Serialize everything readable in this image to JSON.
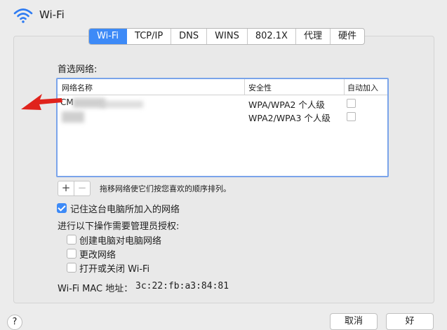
{
  "window": {
    "title": "Wi-Fi"
  },
  "tabs": [
    {
      "label": "Wi-Fi",
      "active": true
    },
    {
      "label": "TCP/IP"
    },
    {
      "label": "DNS"
    },
    {
      "label": "WINS"
    },
    {
      "label": "802.1X"
    },
    {
      "label": "代理"
    },
    {
      "label": "硬件"
    }
  ],
  "preferred": {
    "label": "首选网络:",
    "columns": [
      "网络名称",
      "安全性",
      "自动加入"
    ],
    "rows": [
      {
        "name": "CM",
        "security": "WPA/WPA2 个人级",
        "auto_join": false
      },
      {
        "name": "",
        "security": "WPA2/WPA3 个人级",
        "auto_join": false
      }
    ]
  },
  "controls": {
    "plus": "+",
    "minus": "−",
    "hint": "拖移网络使它们按您喜欢的顺序排列。"
  },
  "remember": {
    "label": "记住这台电脑所加入的网络",
    "checked": true
  },
  "admin": {
    "heading": "进行以下操作需要管理员授权:",
    "options": [
      {
        "label": "创建电脑对电脑网络",
        "checked": false
      },
      {
        "label": "更改网络",
        "checked": false
      },
      {
        "label": "打开或关闭 Wi-Fi",
        "checked": false
      }
    ]
  },
  "mac": {
    "label": "Wi-Fi MAC 地址：",
    "value": "3c:22:fb:a3:84:81"
  },
  "footer": {
    "help": "?",
    "cancel": "取消",
    "ok": "好"
  },
  "colors": {
    "accent": "#3d8af7",
    "arrow": "#e0231c"
  },
  "icons": {
    "wifi": "wifi-icon",
    "arrow": "red-arrow-icon"
  }
}
